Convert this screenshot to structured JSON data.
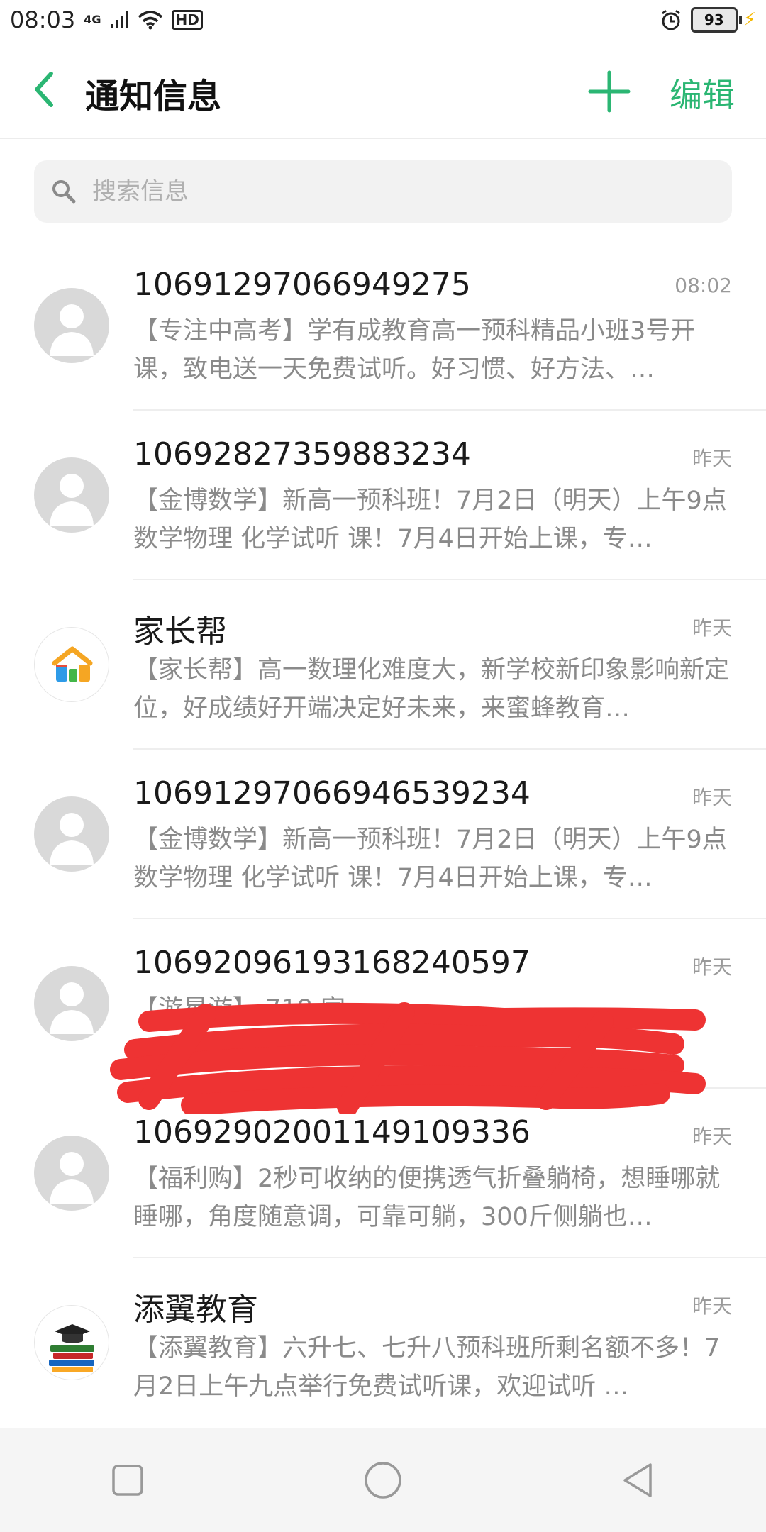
{
  "status_bar": {
    "time": "08:03",
    "network": "4G",
    "hd": "HD",
    "battery": "93"
  },
  "header": {
    "title": "通知信息",
    "edit_label": "编辑"
  },
  "search": {
    "placeholder": "搜索信息"
  },
  "messages": [
    {
      "sender": "10691297066949275",
      "time": "08:02",
      "preview": "【专注中高考】学有成教育高一预科精品小班3号开课，致电送一天免费试听。好习惯、好方法、…",
      "avatar": "default-avatar-icon"
    },
    {
      "sender": "10692827359883234",
      "time": "昨天",
      "preview": "【金博数学】新高一预科班！7月2日（明天）上午9点数学物理 化学试听 课！7月4日开始上课，专…",
      "avatar": "default-avatar-icon"
    },
    {
      "sender": "家长帮",
      "time": "昨天",
      "preview": "【家长帮】高一数理化难度大，新学校新印象影响新定位，好成绩好开端决定好未来，来蜜蜂教育…",
      "avatar": "jiazhangbang-logo-icon"
    },
    {
      "sender": "10691297066946539234",
      "time": "昨天",
      "preview": "【金博数学】新高一预科班！7月2日（明天）上午9点数学物理 化学试听 课！7月4日开始上课，专…",
      "avatar": "default-avatar-icon"
    },
    {
      "sender": "10692096193168240597",
      "time": "昨天",
      "preview": "【游星游】 718 家…",
      "avatar": "default-avatar-icon"
    },
    {
      "sender": "10692902001149109336",
      "time": "昨天",
      "preview": "【福利购】2秒可收纳的便携透气折叠躺椅，想睡哪就睡哪，角度随意调，可靠可躺，300斤侧躺也…",
      "avatar": "default-avatar-icon"
    },
    {
      "sender": "添翼教育",
      "time": "昨天",
      "preview": "【添翼教育】六升七、七升八预科班所剩名额不多！7月2日上午九点举行免费试听课，欢迎试听 …",
      "avatar": "graduation-books-icon"
    }
  ],
  "colors": {
    "accent": "#2bb673",
    "redaction": "#ee3333"
  }
}
